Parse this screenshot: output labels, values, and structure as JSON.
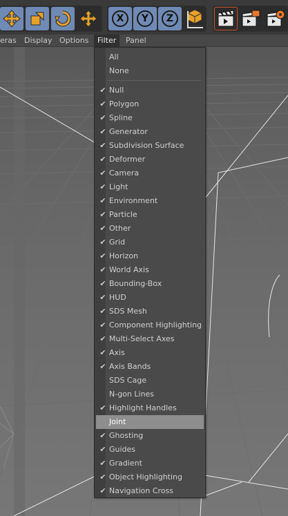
{
  "toolbar": {
    "buttons": [
      {
        "name": "move-icon"
      },
      {
        "name": "scale-icon"
      },
      {
        "name": "rotate-icon"
      },
      {
        "name": "move-tool-icon"
      },
      {
        "name": "x-axis",
        "label": "X"
      },
      {
        "name": "y-axis",
        "label": "Y"
      },
      {
        "name": "z-axis",
        "label": "Z"
      },
      {
        "name": "coordinate-system-icon"
      },
      {
        "name": "render-view-icon"
      },
      {
        "name": "render-picture-viewer-icon"
      },
      {
        "name": "render-settings-icon"
      }
    ],
    "colors": {
      "active_blue": "#6f8ab4",
      "accent_orange": "#e8772e"
    }
  },
  "menubar": {
    "items": [
      "eras",
      "Display",
      "Options",
      "Filter",
      "Panel"
    ],
    "active": "Filter"
  },
  "filter_menu": {
    "top_items": [
      "All",
      "None"
    ],
    "items": [
      {
        "label": "Null",
        "checked": true
      },
      {
        "label": "Polygon",
        "checked": true
      },
      {
        "label": "Spline",
        "checked": true
      },
      {
        "label": "Generator",
        "checked": true
      },
      {
        "label": "Subdivision Surface",
        "checked": true
      },
      {
        "label": "Deformer",
        "checked": true
      },
      {
        "label": "Camera",
        "checked": true
      },
      {
        "label": "Light",
        "checked": true
      },
      {
        "label": "Environment",
        "checked": true
      },
      {
        "label": "Particle",
        "checked": true
      },
      {
        "label": "Other",
        "checked": true
      },
      {
        "label": "Grid",
        "checked": true
      },
      {
        "label": "Horizon",
        "checked": true
      },
      {
        "label": "World Axis",
        "checked": true
      },
      {
        "label": "Bounding-Box",
        "checked": true
      },
      {
        "label": "HUD",
        "checked": true
      },
      {
        "label": "SDS Mesh",
        "checked": true
      },
      {
        "label": "Component Highlighting",
        "checked": true
      },
      {
        "label": "Multi-Select Axes",
        "checked": true
      },
      {
        "label": "Axis",
        "checked": true
      },
      {
        "label": "Axis Bands",
        "checked": true
      },
      {
        "label": "SDS Cage",
        "checked": false
      },
      {
        "label": "N-gon Lines",
        "checked": false
      },
      {
        "label": "Highlight Handles",
        "checked": true
      },
      {
        "label": "Joint",
        "checked": false,
        "highlighted": true
      },
      {
        "label": "Ghosting",
        "checked": true
      },
      {
        "label": "Guides",
        "checked": true
      },
      {
        "label": "Gradient",
        "checked": true
      },
      {
        "label": "Object Highlighting",
        "checked": true
      },
      {
        "label": "Navigation Cross",
        "checked": true
      }
    ],
    "check_glyph": "✔"
  }
}
